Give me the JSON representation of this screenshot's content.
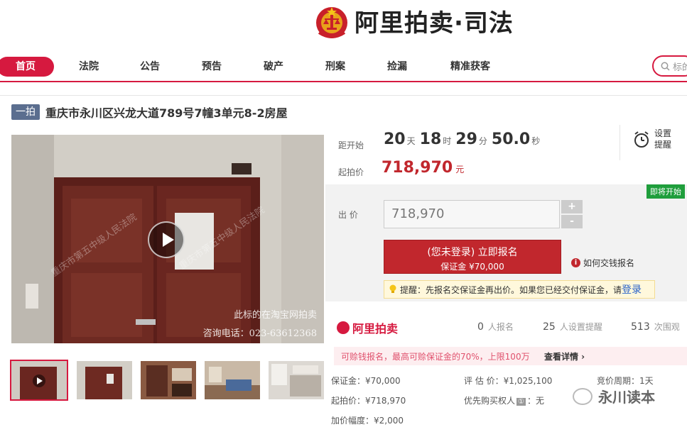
{
  "header": {
    "logo_text": "阿里拍卖·司法"
  },
  "nav": {
    "items": [
      "首页",
      "法院",
      "公告",
      "预告",
      "破产",
      "刑案",
      "捡漏",
      "精准获客"
    ],
    "search_placeholder": "标的"
  },
  "listing": {
    "badge": "一拍",
    "title": "重庆市永川区兴龙大道789号7幢3单元8-2房屋"
  },
  "image": {
    "watermark_lines": [
      "重庆市第五中级人民法院",
      "重庆市第五中级人民法院"
    ],
    "caption_line1": "此标的在淘宝网拍卖",
    "caption_line2": "咨询电话：023-63612368"
  },
  "countdown": {
    "label": "距开始",
    "days": "20",
    "days_unit": "天",
    "hours": "18",
    "hours_unit": "时",
    "minutes": "29",
    "minutes_unit": "分",
    "seconds": "50.0",
    "seconds_unit": "秒"
  },
  "reminder": {
    "line1": "设置",
    "line2": "提醒"
  },
  "price": {
    "label": "起拍价",
    "value": "718,970",
    "unit": "元"
  },
  "bid": {
    "status_tag": "即将开始",
    "label": "出 价",
    "value": "718,970",
    "plus": "+",
    "minus": "-",
    "signup_line1": "(您未登录) 立即报名",
    "signup_line2": "保证金 ¥70,000",
    "howto": "如何交钱报名",
    "tip_text": "提醒：先报名交保证金再出价。如果您已经交付保证金，请",
    "tip_link": "登录"
  },
  "platform": {
    "name": "阿里拍卖",
    "signups_num": "0",
    "signups_label": "人报名",
    "reminders_num": "25",
    "reminders_label": "人设置提醒",
    "views_num": "513",
    "views_label": "次围观"
  },
  "promo": {
    "text": "可赊钱报名，最高可赊保证金的70%，上限100万",
    "link": "查看详情 ›"
  },
  "details": {
    "deposit": "保证金：¥70,000",
    "eval": "评 估 价：¥1,025,100",
    "period": "竞价周期：1天",
    "start_price": "起拍价：¥718,970",
    "priority": "优先购买权人",
    "priority_badge": "①",
    "priority_value": "：无",
    "increment": "加价幅度：¥2,000"
  },
  "wechat_watermark": "永川读本",
  "colors": {
    "brand_red": "#d6193f",
    "price_red": "#c1272d",
    "badge_blue": "#5b6e8f",
    "green_tag": "#1f9e3c"
  }
}
